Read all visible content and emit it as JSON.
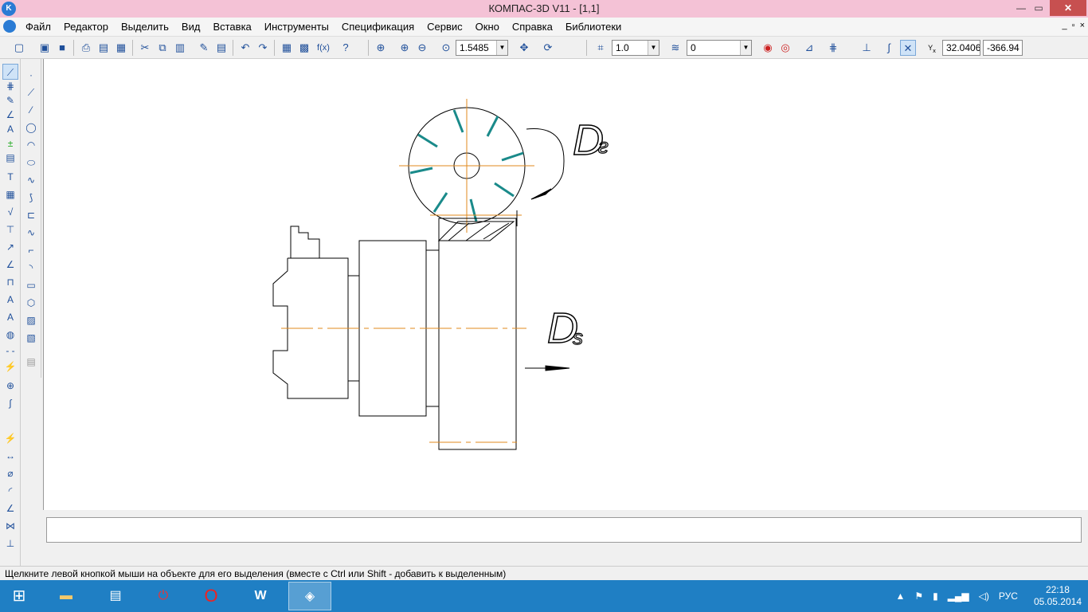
{
  "window": {
    "title": "КОМПАС-3D V11 - [1,1]",
    "app_icon": "K",
    "controls": {
      "minimize": "—",
      "maximize": "▭",
      "close": "✕"
    }
  },
  "menu": {
    "items": [
      "Файл",
      "Редактор",
      "Выделить",
      "Вид",
      "Вставка",
      "Инструменты",
      "Спецификация",
      "Сервис",
      "Окно",
      "Справка",
      "Библиотеки"
    ],
    "mdi_controls": [
      "_",
      "▫",
      "×"
    ]
  },
  "toolbar": {
    "icons": [
      "new-icon",
      "open-icon",
      "save-icon",
      "print-icon",
      "preview-icon",
      "cut-icon",
      "copy-icon",
      "paste-icon",
      "undo-icon",
      "redo-icon",
      "zoom-icon",
      "pan-icon",
      "layer-icon",
      "grid-icon",
      "snap-icon"
    ],
    "zoom_value": "1.5485",
    "step_value": "1.0",
    "layer_value": "0",
    "coord_x": "32.0406",
    "coord_y": "-366.94",
    "fx_label": "f(x)",
    "coord_axis_label": "Y",
    "coord_axis_sub": "x"
  },
  "left_tools": {
    "column1": [
      "geometry-icon",
      "dimensions-icon",
      "notation-icon",
      "edit-icon",
      "parametrize-icon",
      "measure-icon",
      "select-icon",
      "associative-icon",
      "spec-icon",
      "report-icon",
      "insert-icon",
      "table-icon"
    ],
    "column2": [
      "point-icon",
      "auxiliary-line-icon",
      "segment-icon",
      "circle-icon",
      "arc-icon",
      "ellipse-icon",
      "spline-icon",
      "polyline-icon",
      "chamfer-icon",
      "fillet-icon",
      "rectangle-icon",
      "polygon-icon",
      "hatch-icon",
      "fill-icon",
      "contour-icon"
    ]
  },
  "drawing": {
    "label_d1": "D",
    "label_d1_sub": "г",
    "label_d2": "D",
    "label_d2_sub": "s",
    "colors": {
      "teeth": "#1a8a8a",
      "centerline": "#e08a1e",
      "outline": "#000000"
    }
  },
  "status": {
    "text": "Щелкните левой кнопкой мыши на объекте для его выделения (вместе с Ctrl или Shift - добавить к выделенным)"
  },
  "taskbar": {
    "apps": [
      "start-icon",
      "explorer-icon",
      "control-panel-icon",
      "power-icon",
      "opera-icon",
      "word-icon",
      "kompas-icon"
    ],
    "tray_language": "РУС",
    "time": "22:18",
    "date": "05.05.2014"
  }
}
